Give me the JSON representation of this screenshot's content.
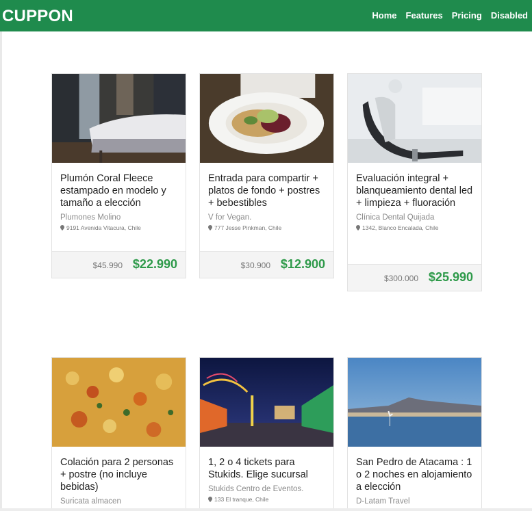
{
  "brand": "CUPPON",
  "nav": [
    "Home",
    "Features",
    "Pricing",
    "Disabled"
  ],
  "deals": [
    {
      "title": "Plumón Coral Fleece estampado en modelo y tamaño a elección",
      "vendor": "Plumones Molino",
      "address": "9191 Avenida Vitacura, Chile",
      "old_price": "$45.990",
      "new_price": "$22.990",
      "image": "bedroom-photo"
    },
    {
      "title": "Entrada para compartir + platos de fondo + postres + bebestibles",
      "vendor": "V for Vegan.",
      "address": "777 Jesse Pinkman, Chile",
      "old_price": "$30.900",
      "new_price": "$12.900",
      "image": "salad-plate-photo"
    },
    {
      "title": "Evaluación integral + blanqueamiento dental led + limpieza + fluoración",
      "vendor": "Clínica Dental Quijada",
      "address": "1342, Blanco Encalada, Chile",
      "old_price": "$300.000",
      "new_price": "$25.990",
      "image": "dental-chair-photo"
    },
    {
      "title": "Colación para 2 personas + postre (no incluye bebidas)",
      "vendor": "Suricata almacen",
      "address": "",
      "old_price": "",
      "new_price": "",
      "image": "food-dish-photo"
    },
    {
      "title": "1, 2 o 4 tickets para Stukids. Elige sucursal",
      "vendor": "Stukids Centro de Eventos.",
      "address": "133 El tranque, Chile",
      "old_price": "",
      "new_price": "",
      "image": "night-fair-photo"
    },
    {
      "title": "San Pedro de Atacama : 1 o 2 noches en alojamiento a elección",
      "vendor": "D-Latam Travel",
      "address": "",
      "old_price": "",
      "new_price": "",
      "image": "atacama-lake-photo"
    }
  ]
}
